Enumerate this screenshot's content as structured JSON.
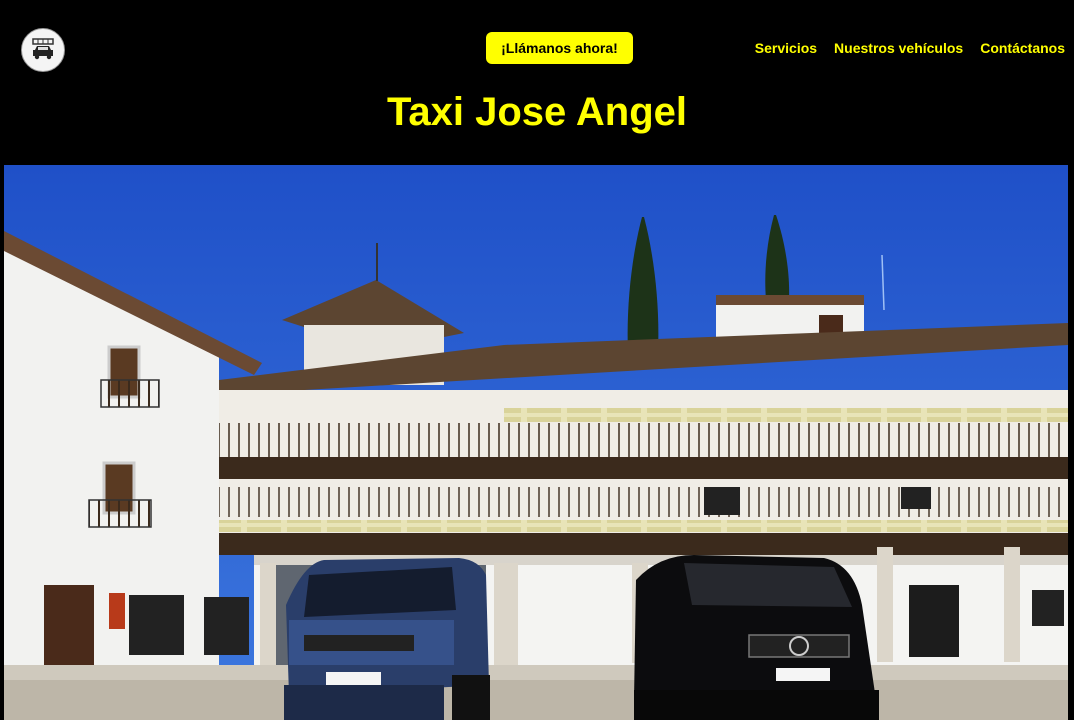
{
  "header": {
    "logo_icon": "taxi-car-icon",
    "cta_label": "¡Llámanos ahora!",
    "nav": [
      {
        "label": "Servicios"
      },
      {
        "label": "Nuestros vehículos"
      },
      {
        "label": "Contáctanos"
      }
    ],
    "title": "Taxi Jose Angel"
  },
  "colors": {
    "background": "#000000",
    "accent": "#ffff00"
  },
  "hero": {
    "image_icon": "plaza-with-taxis-photo"
  }
}
